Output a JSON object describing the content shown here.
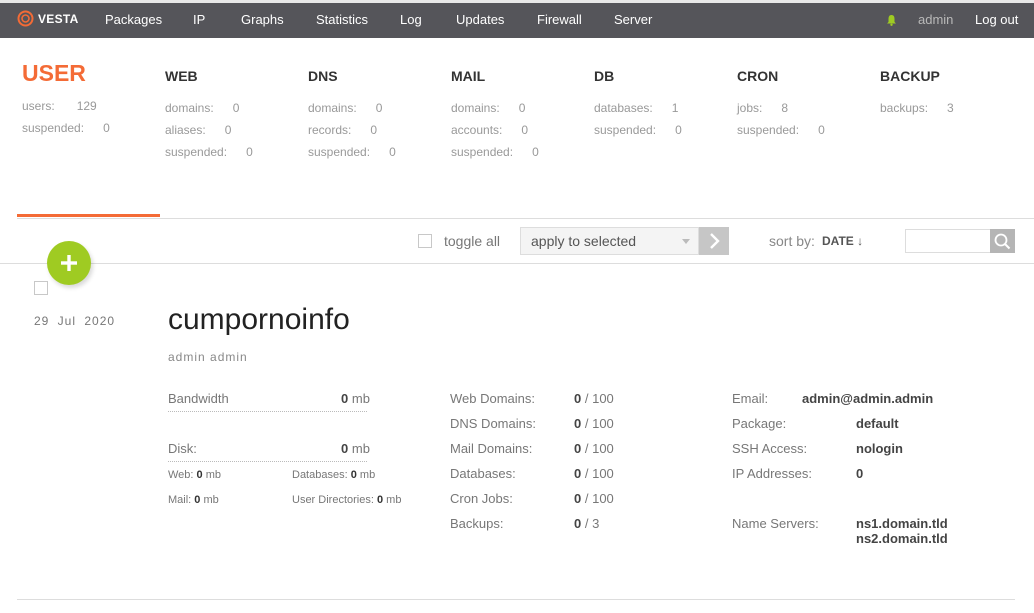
{
  "brand": {
    "name": "VESTA",
    "accent": "#f46b36",
    "logo_icon": "vesta-ring-icon"
  },
  "nav": {
    "items": [
      "Packages",
      "IP",
      "Graphs",
      "Statistics",
      "Log",
      "Updates",
      "Firewall",
      "Server"
    ],
    "notification_icon": "bell-icon",
    "user": "admin",
    "logout": "Log out"
  },
  "stats": {
    "user": {
      "title": "USER",
      "rows": [
        {
          "label": "users:",
          "value": "129"
        },
        {
          "label": "suspended:",
          "value": "0"
        }
      ]
    },
    "web": {
      "title": "WEB",
      "rows": [
        {
          "label": "domains:",
          "value": "0"
        },
        {
          "label": "aliases:",
          "value": "0"
        },
        {
          "label": "suspended:",
          "value": "0"
        }
      ]
    },
    "dns": {
      "title": "DNS",
      "rows": [
        {
          "label": "domains:",
          "value": "0"
        },
        {
          "label": "records:",
          "value": "0"
        },
        {
          "label": "suspended:",
          "value": "0"
        }
      ]
    },
    "mail": {
      "title": "MAIL",
      "rows": [
        {
          "label": "domains:",
          "value": "0"
        },
        {
          "label": "accounts:",
          "value": "0"
        },
        {
          "label": "suspended:",
          "value": "0"
        }
      ]
    },
    "db": {
      "title": "DB",
      "rows": [
        {
          "label": "databases:",
          "value": "1"
        },
        {
          "label": "suspended:",
          "value": "0"
        }
      ]
    },
    "cron": {
      "title": "CRON",
      "rows": [
        {
          "label": "jobs:",
          "value": "8"
        },
        {
          "label": "suspended:",
          "value": "0"
        }
      ]
    },
    "backup": {
      "title": "BACKUP",
      "rows": [
        {
          "label": "backups:",
          "value": "3"
        }
      ]
    }
  },
  "toolbar": {
    "toggle_all": "toggle all",
    "apply_selected": "apply to selected",
    "sort_by": "sort by:",
    "sort_value": "DATE ↓",
    "search_placeholder": ""
  },
  "user_entry": {
    "date": "29 Jul 2020",
    "username": "cumpornoinfo",
    "fullname": "admin admin",
    "bandwidth": {
      "label": "Bandwidth",
      "value": "0",
      "unit": "mb"
    },
    "disk": {
      "label": "Disk:",
      "value": "0",
      "unit": "mb"
    },
    "disk_breakdown": {
      "web_label": "Web:",
      "web_value": "0",
      "web_unit": "mb",
      "db_label": "Databases:",
      "db_value": "0",
      "db_unit": "mb",
      "mail_label": "Mail:",
      "mail_value": "0",
      "mail_unit": "mb",
      "udir_label": "User Directories:",
      "udir_value": "0",
      "udir_unit": "mb"
    },
    "limits": [
      {
        "label": "Web Domains:",
        "used": "0",
        "limit": "/ 100"
      },
      {
        "label": "DNS Domains:",
        "used": "0",
        "limit": "/ 100"
      },
      {
        "label": "Mail Domains:",
        "used": "0",
        "limit": "/ 100"
      },
      {
        "label": "Databases:",
        "used": "0",
        "limit": "/ 100"
      },
      {
        "label": "Cron Jobs:",
        "used": "0",
        "limit": "/ 100"
      },
      {
        "label": "Backups:",
        "used": "0",
        "limit": "/ 3"
      }
    ],
    "info": {
      "email_label": "Email:",
      "email": "admin@admin.admin",
      "package_label": "Package:",
      "package": "default",
      "ssh_label": "SSH Access:",
      "ssh": "nologin",
      "ip_label": "IP Addresses:",
      "ip": "0",
      "ns_label": "Name Servers:",
      "ns1": "ns1.domain.tld",
      "ns2": "ns2.domain.tld"
    }
  }
}
